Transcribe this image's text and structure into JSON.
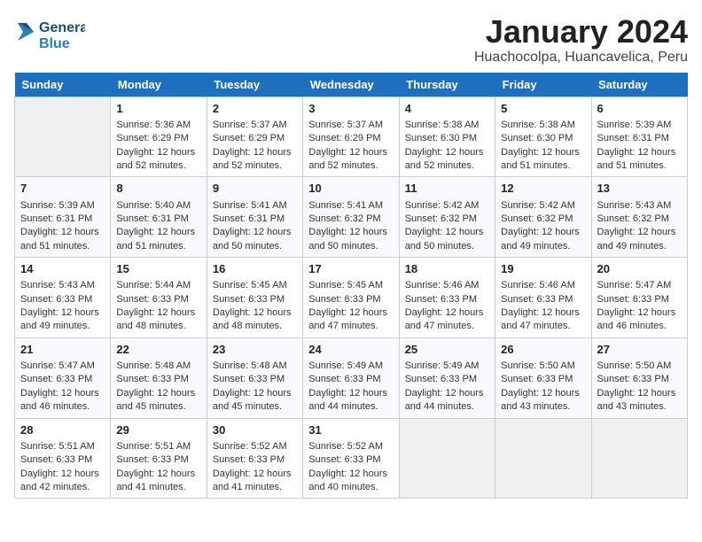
{
  "header": {
    "logo_general": "General",
    "logo_blue": "Blue",
    "month_title": "January 2024",
    "location": "Huachocolpa, Huancavelica, Peru"
  },
  "calendar": {
    "days_of_week": [
      "Sunday",
      "Monday",
      "Tuesday",
      "Wednesday",
      "Thursday",
      "Friday",
      "Saturday"
    ],
    "weeks": [
      [
        {
          "num": "",
          "lines": []
        },
        {
          "num": "1",
          "lines": [
            "Sunrise: 5:36 AM",
            "Sunset: 6:29 PM",
            "Daylight: 12 hours",
            "and 52 minutes."
          ]
        },
        {
          "num": "2",
          "lines": [
            "Sunrise: 5:37 AM",
            "Sunset: 6:29 PM",
            "Daylight: 12 hours",
            "and 52 minutes."
          ]
        },
        {
          "num": "3",
          "lines": [
            "Sunrise: 5:37 AM",
            "Sunset: 6:29 PM",
            "Daylight: 12 hours",
            "and 52 minutes."
          ]
        },
        {
          "num": "4",
          "lines": [
            "Sunrise: 5:38 AM",
            "Sunset: 6:30 PM",
            "Daylight: 12 hours",
            "and 52 minutes."
          ]
        },
        {
          "num": "5",
          "lines": [
            "Sunrise: 5:38 AM",
            "Sunset: 6:30 PM",
            "Daylight: 12 hours",
            "and 51 minutes."
          ]
        },
        {
          "num": "6",
          "lines": [
            "Sunrise: 5:39 AM",
            "Sunset: 6:31 PM",
            "Daylight: 12 hours",
            "and 51 minutes."
          ]
        }
      ],
      [
        {
          "num": "7",
          "lines": [
            "Sunrise: 5:39 AM",
            "Sunset: 6:31 PM",
            "Daylight: 12 hours",
            "and 51 minutes."
          ]
        },
        {
          "num": "8",
          "lines": [
            "Sunrise: 5:40 AM",
            "Sunset: 6:31 PM",
            "Daylight: 12 hours",
            "and 51 minutes."
          ]
        },
        {
          "num": "9",
          "lines": [
            "Sunrise: 5:41 AM",
            "Sunset: 6:31 PM",
            "Daylight: 12 hours",
            "and 50 minutes."
          ]
        },
        {
          "num": "10",
          "lines": [
            "Sunrise: 5:41 AM",
            "Sunset: 6:32 PM",
            "Daylight: 12 hours",
            "and 50 minutes."
          ]
        },
        {
          "num": "11",
          "lines": [
            "Sunrise: 5:42 AM",
            "Sunset: 6:32 PM",
            "Daylight: 12 hours",
            "and 50 minutes."
          ]
        },
        {
          "num": "12",
          "lines": [
            "Sunrise: 5:42 AM",
            "Sunset: 6:32 PM",
            "Daylight: 12 hours",
            "and 49 minutes."
          ]
        },
        {
          "num": "13",
          "lines": [
            "Sunrise: 5:43 AM",
            "Sunset: 6:32 PM",
            "Daylight: 12 hours",
            "and 49 minutes."
          ]
        }
      ],
      [
        {
          "num": "14",
          "lines": [
            "Sunrise: 5:43 AM",
            "Sunset: 6:33 PM",
            "Daylight: 12 hours",
            "and 49 minutes."
          ]
        },
        {
          "num": "15",
          "lines": [
            "Sunrise: 5:44 AM",
            "Sunset: 6:33 PM",
            "Daylight: 12 hours",
            "and 48 minutes."
          ]
        },
        {
          "num": "16",
          "lines": [
            "Sunrise: 5:45 AM",
            "Sunset: 6:33 PM",
            "Daylight: 12 hours",
            "and 48 minutes."
          ]
        },
        {
          "num": "17",
          "lines": [
            "Sunrise: 5:45 AM",
            "Sunset: 6:33 PM",
            "Daylight: 12 hours",
            "and 47 minutes."
          ]
        },
        {
          "num": "18",
          "lines": [
            "Sunrise: 5:46 AM",
            "Sunset: 6:33 PM",
            "Daylight: 12 hours",
            "and 47 minutes."
          ]
        },
        {
          "num": "19",
          "lines": [
            "Sunrise: 5:46 AM",
            "Sunset: 6:33 PM",
            "Daylight: 12 hours",
            "and 47 minutes."
          ]
        },
        {
          "num": "20",
          "lines": [
            "Sunrise: 5:47 AM",
            "Sunset: 6:33 PM",
            "Daylight: 12 hours",
            "and 46 minutes."
          ]
        }
      ],
      [
        {
          "num": "21",
          "lines": [
            "Sunrise: 5:47 AM",
            "Sunset: 6:33 PM",
            "Daylight: 12 hours",
            "and 46 minutes."
          ]
        },
        {
          "num": "22",
          "lines": [
            "Sunrise: 5:48 AM",
            "Sunset: 6:33 PM",
            "Daylight: 12 hours",
            "and 45 minutes."
          ]
        },
        {
          "num": "23",
          "lines": [
            "Sunrise: 5:48 AM",
            "Sunset: 6:33 PM",
            "Daylight: 12 hours",
            "and 45 minutes."
          ]
        },
        {
          "num": "24",
          "lines": [
            "Sunrise: 5:49 AM",
            "Sunset: 6:33 PM",
            "Daylight: 12 hours",
            "and 44 minutes."
          ]
        },
        {
          "num": "25",
          "lines": [
            "Sunrise: 5:49 AM",
            "Sunset: 6:33 PM",
            "Daylight: 12 hours",
            "and 44 minutes."
          ]
        },
        {
          "num": "26",
          "lines": [
            "Sunrise: 5:50 AM",
            "Sunset: 6:33 PM",
            "Daylight: 12 hours",
            "and 43 minutes."
          ]
        },
        {
          "num": "27",
          "lines": [
            "Sunrise: 5:50 AM",
            "Sunset: 6:33 PM",
            "Daylight: 12 hours",
            "and 43 minutes."
          ]
        }
      ],
      [
        {
          "num": "28",
          "lines": [
            "Sunrise: 5:51 AM",
            "Sunset: 6:33 PM",
            "Daylight: 12 hours",
            "and 42 minutes."
          ]
        },
        {
          "num": "29",
          "lines": [
            "Sunrise: 5:51 AM",
            "Sunset: 6:33 PM",
            "Daylight: 12 hours",
            "and 41 minutes."
          ]
        },
        {
          "num": "30",
          "lines": [
            "Sunrise: 5:52 AM",
            "Sunset: 6:33 PM",
            "Daylight: 12 hours",
            "and 41 minutes."
          ]
        },
        {
          "num": "31",
          "lines": [
            "Sunrise: 5:52 AM",
            "Sunset: 6:33 PM",
            "Daylight: 12 hours",
            "and 40 minutes."
          ]
        },
        {
          "num": "",
          "lines": []
        },
        {
          "num": "",
          "lines": []
        },
        {
          "num": "",
          "lines": []
        }
      ]
    ]
  }
}
